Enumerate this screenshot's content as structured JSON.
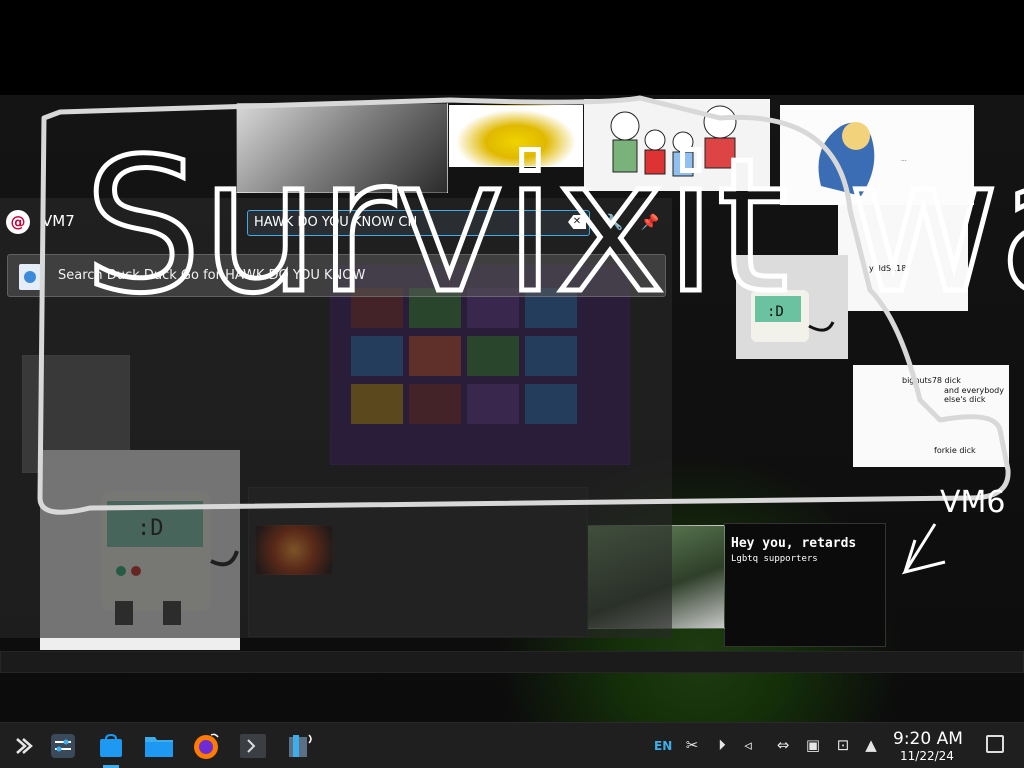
{
  "launcher": {
    "app_name": "VM7",
    "query": "HAWK DO YOU KNOW CH",
    "clear_icon": "clear-text-icon",
    "configure_icon": "wrench-icon",
    "pin_icon": "pin-icon",
    "results": [
      {
        "label": "Search Duck Duck Go for HAWK DO YOU KNOW",
        "icon": "web-search-icon"
      }
    ]
  },
  "collage": {
    "hey_title": "Hey you, retards",
    "hey_sub": "Lgbtq supporters",
    "doc_text": [
      "bignuts78 dick",
      "and everybody else's dick",
      "forkie dick"
    ],
    "cat_caption_label": "yeldS118"
  },
  "scribble_text": "Survixit was here",
  "vm6_label": "VM6",
  "taskbar": {
    "apps": [
      "application-launcher",
      "system-settings",
      "discover",
      "file-manager",
      "firefox",
      "konsole",
      "video-app"
    ],
    "language": "EN",
    "time": "9:20 AM",
    "date": "11/22/24",
    "accent": "#3daee9"
  }
}
